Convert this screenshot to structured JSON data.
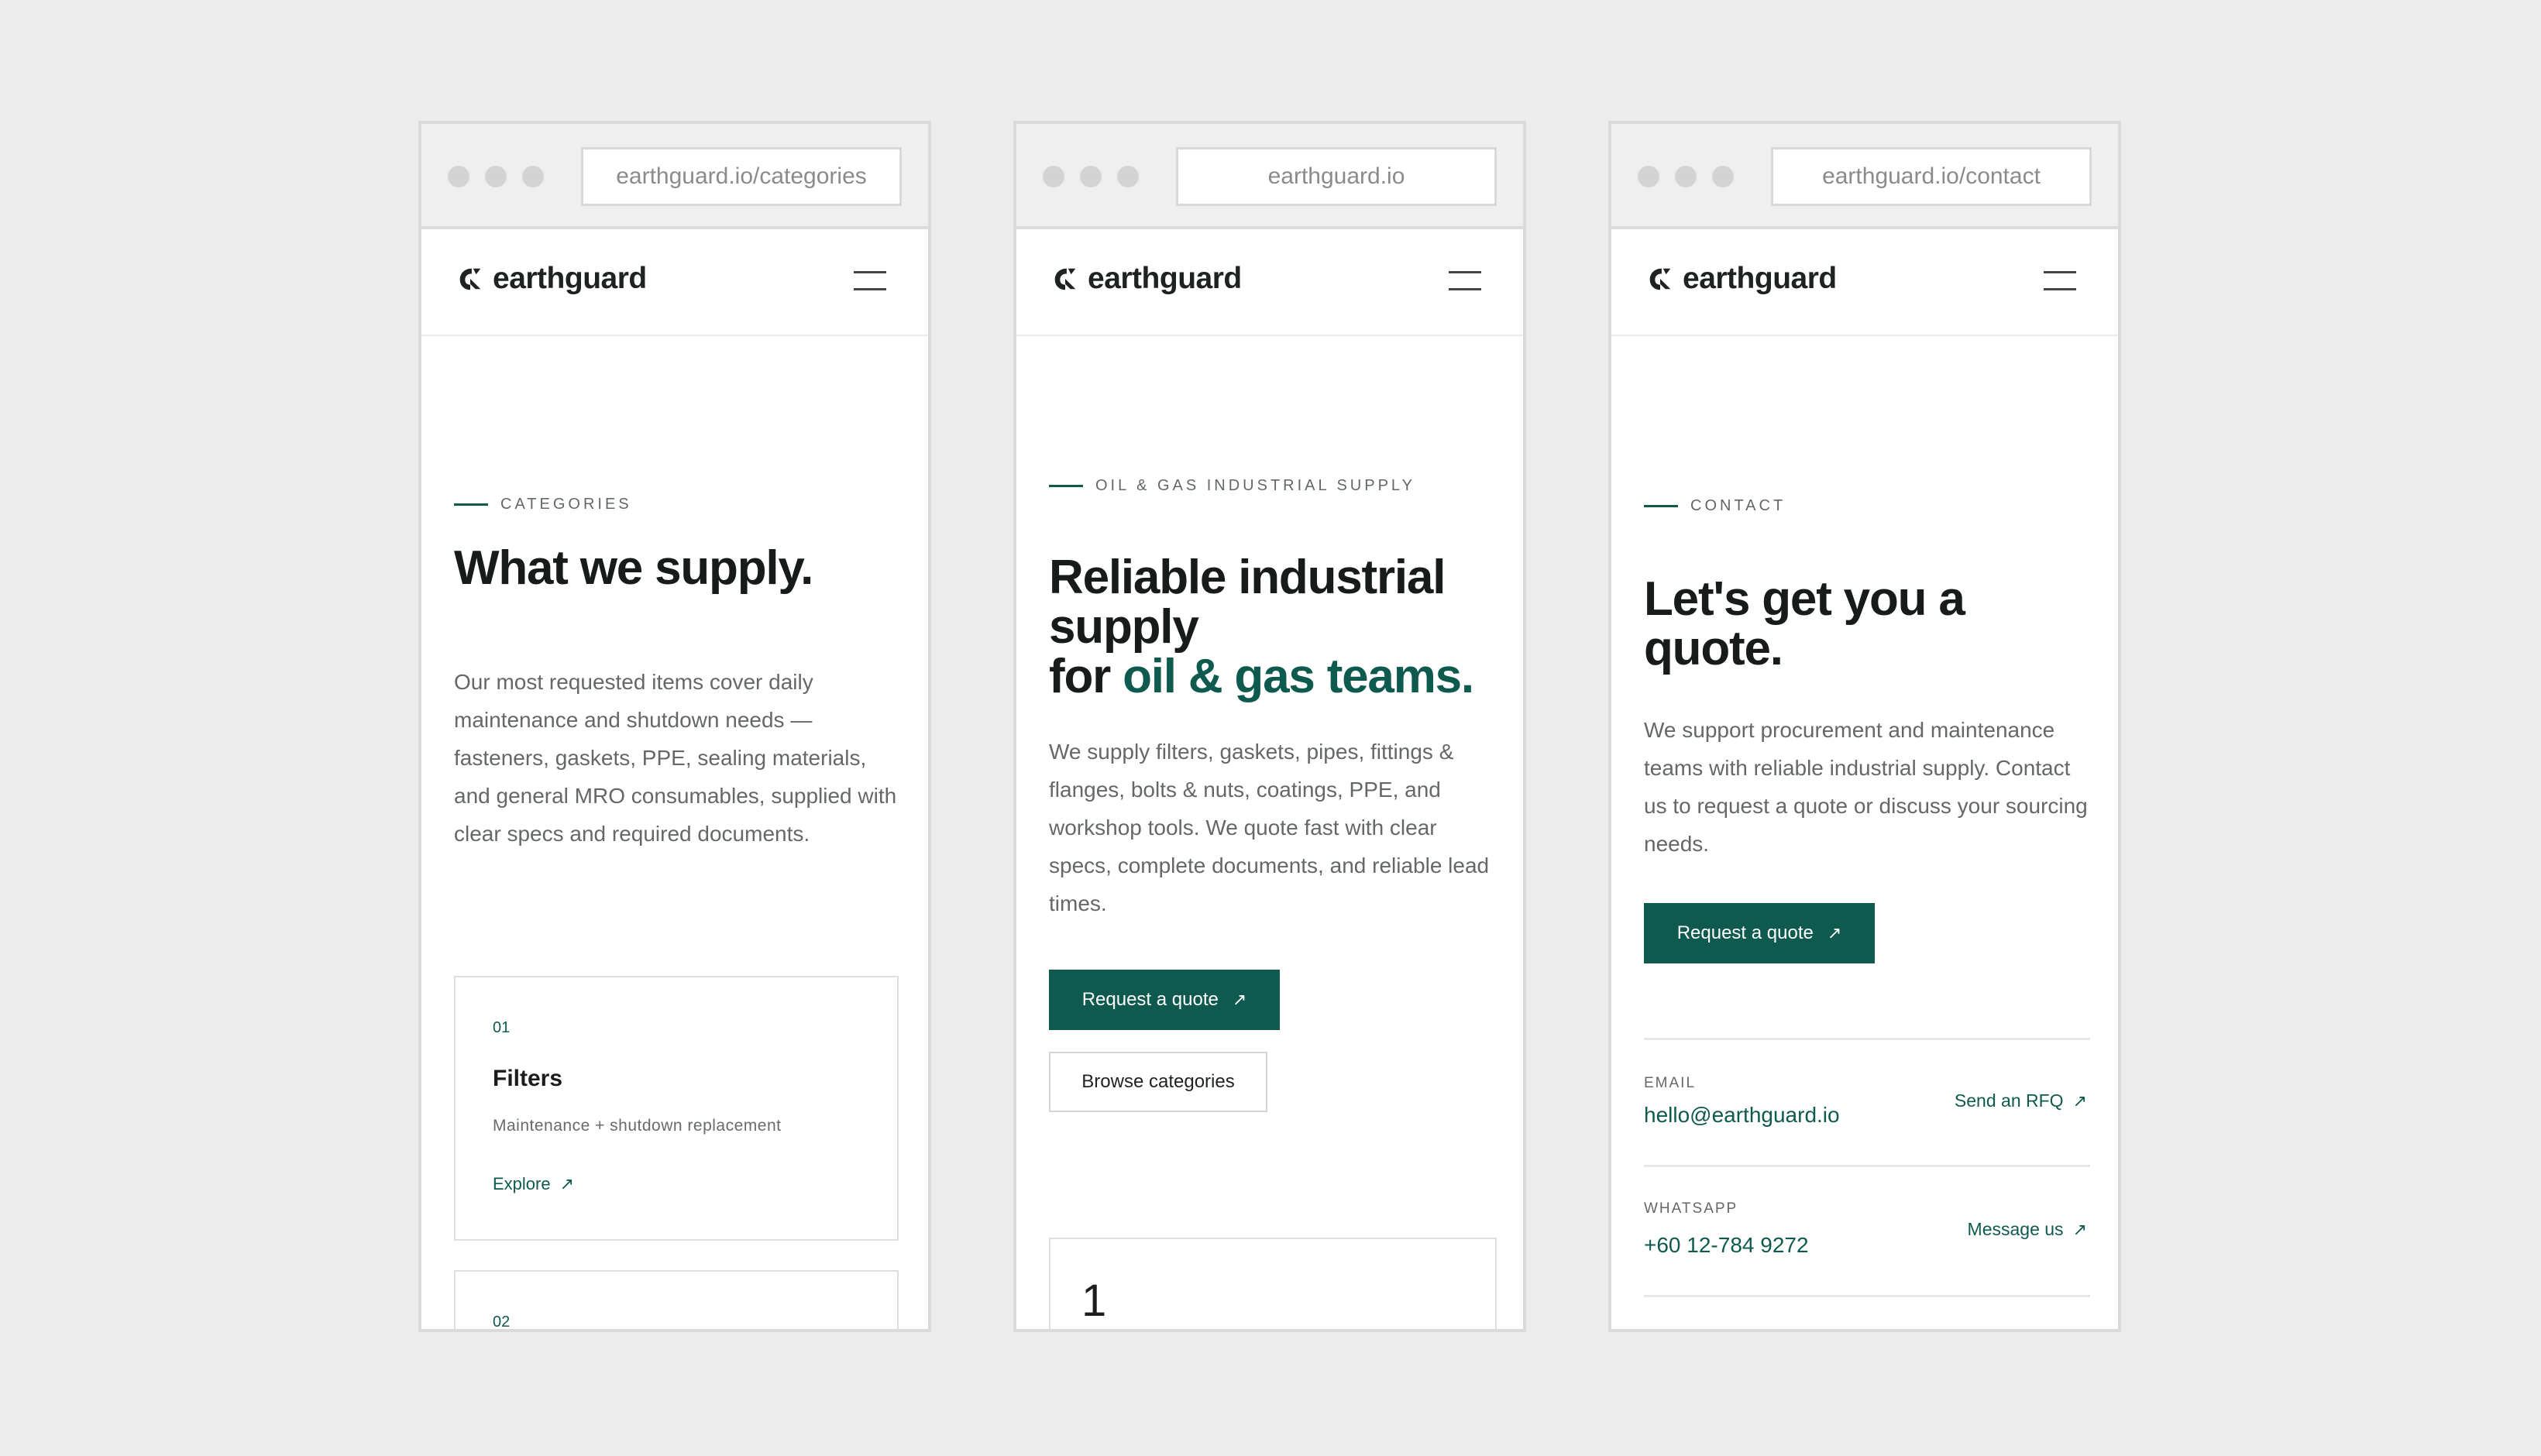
{
  "brand": {
    "name": "earthguard",
    "accent": "#0f5a4f"
  },
  "screens": [
    {
      "url": "earthguard.io/categories",
      "eyebrow": "CATEGORIES",
      "title": "What we supply.",
      "body": "Our most requested items cover daily maintenance and shutdown needs — fasteners, gaskets, PPE, sealing materials, and general MRO consumables, supplied with clear specs and required documents.",
      "cards": [
        {
          "num": "01",
          "title": "Filters",
          "subtitle": "Maintenance + shutdown replacement",
          "link": "Explore"
        },
        {
          "num": "02"
        }
      ]
    },
    {
      "url": "earthguard.io",
      "eyebrow": "OIL & GAS INDUSTRIAL SUPPLY",
      "title_line1": "Reliable industrial",
      "title_line2": "supply",
      "title_line3_prefix": "for ",
      "title_line3_accent": "oil & gas teams.",
      "body": "We supply filters, gaskets, pipes, fittings & flanges, bolts & nuts, coatings, PPE, and workshop tools. We quote fast with clear specs, complete documents, and reliable lead times.",
      "primary_button": "Request a quote",
      "secondary_button": "Browse categories",
      "stat_number": "1"
    },
    {
      "url": "earthguard.io/contact",
      "eyebrow": "CONTACT",
      "title_line1": "Let's get you a",
      "title_line2": "quote.",
      "body": "We support procurement and maintenance teams with reliable industrial supply. Contact us to request a quote or discuss your sourcing needs.",
      "primary_button": "Request a quote",
      "contacts": [
        {
          "label": "EMAIL",
          "value": "hello@earthguard.io",
          "action": "Send an RFQ"
        },
        {
          "label": "WHATSAPP",
          "value": "+60 12-784 9272",
          "action": "Message us"
        }
      ]
    }
  ],
  "icons": {
    "external": "arrow-up-right-icon",
    "menu": "hamburger-icon",
    "logo": "earthguard-logo-icon"
  }
}
